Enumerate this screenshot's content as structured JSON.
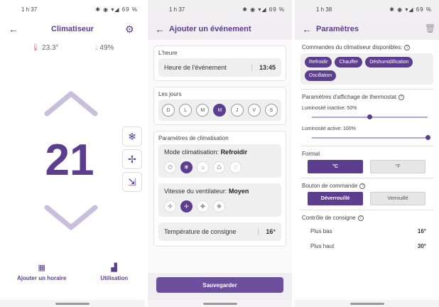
{
  "screen1": {
    "status_time": "1 h 37",
    "status_icons": "✱ ◉ ▾◢ 69 %",
    "title": "Climatiseur",
    "current_temp": "23.3°",
    "humidity": "49%",
    "setpoint": "21",
    "action_schedule": "Ajouter un horaire",
    "action_usage": "Utilisation"
  },
  "screen2": {
    "status_time": "1 h 37",
    "status_icons": "✱ ◉ ▾◢ 69 %",
    "title": "Ajouter un événement",
    "time_section": "L'heure",
    "time_label": "Heure de l'événement",
    "time_value": "13:45",
    "days_section": "Les jours",
    "days": [
      "D",
      "L",
      "M",
      "M",
      "J",
      "V",
      "S"
    ],
    "active_day_index": 3,
    "climate_section": "Paramètres de climatisation",
    "mode_label": "Mode climatisation:",
    "mode_value": "Refroidir",
    "fan_label": "Vitesse du ventilateur:",
    "fan_value": "Moyen",
    "setpoint_label": "Température de consigne",
    "setpoint_value": "16°",
    "save_label": "Sauvegarder"
  },
  "screen3": {
    "status_time": "1 h 38",
    "status_icons": "✱ ◉ ▾◢ 69 %",
    "title": "Paramètres",
    "commands_heading": "Commandes du climatiseur disponibles:",
    "commands": [
      "Refroidir",
      "Chauffer",
      "Déshumidification",
      "Oscillation"
    ],
    "display_heading": "Paramètres d'affichage de thermostat",
    "inactive_brightness_label": "Luminosité inactive: 50%",
    "inactive_brightness_value": 0.5,
    "active_brightness_label": "Luminosité active: 100%",
    "active_brightness_value": 1.0,
    "format_heading": "Format",
    "format_c": "°C",
    "format_f": "°F",
    "button_heading": "Bouton de commande",
    "unlocked_label": "Déverrouillé",
    "locked_label": "Verrouillé",
    "setpoint_heading": "Contrôle de consigne",
    "lower_label": "Plus bas",
    "lower_value": "16°",
    "upper_label": "Plus haut",
    "upper_value": "30°"
  },
  "colors": {
    "primary": "#5c3d8f",
    "accent_light": "#b8a6d4",
    "therm": "#e57399",
    "drop": "#3aa1d9"
  }
}
